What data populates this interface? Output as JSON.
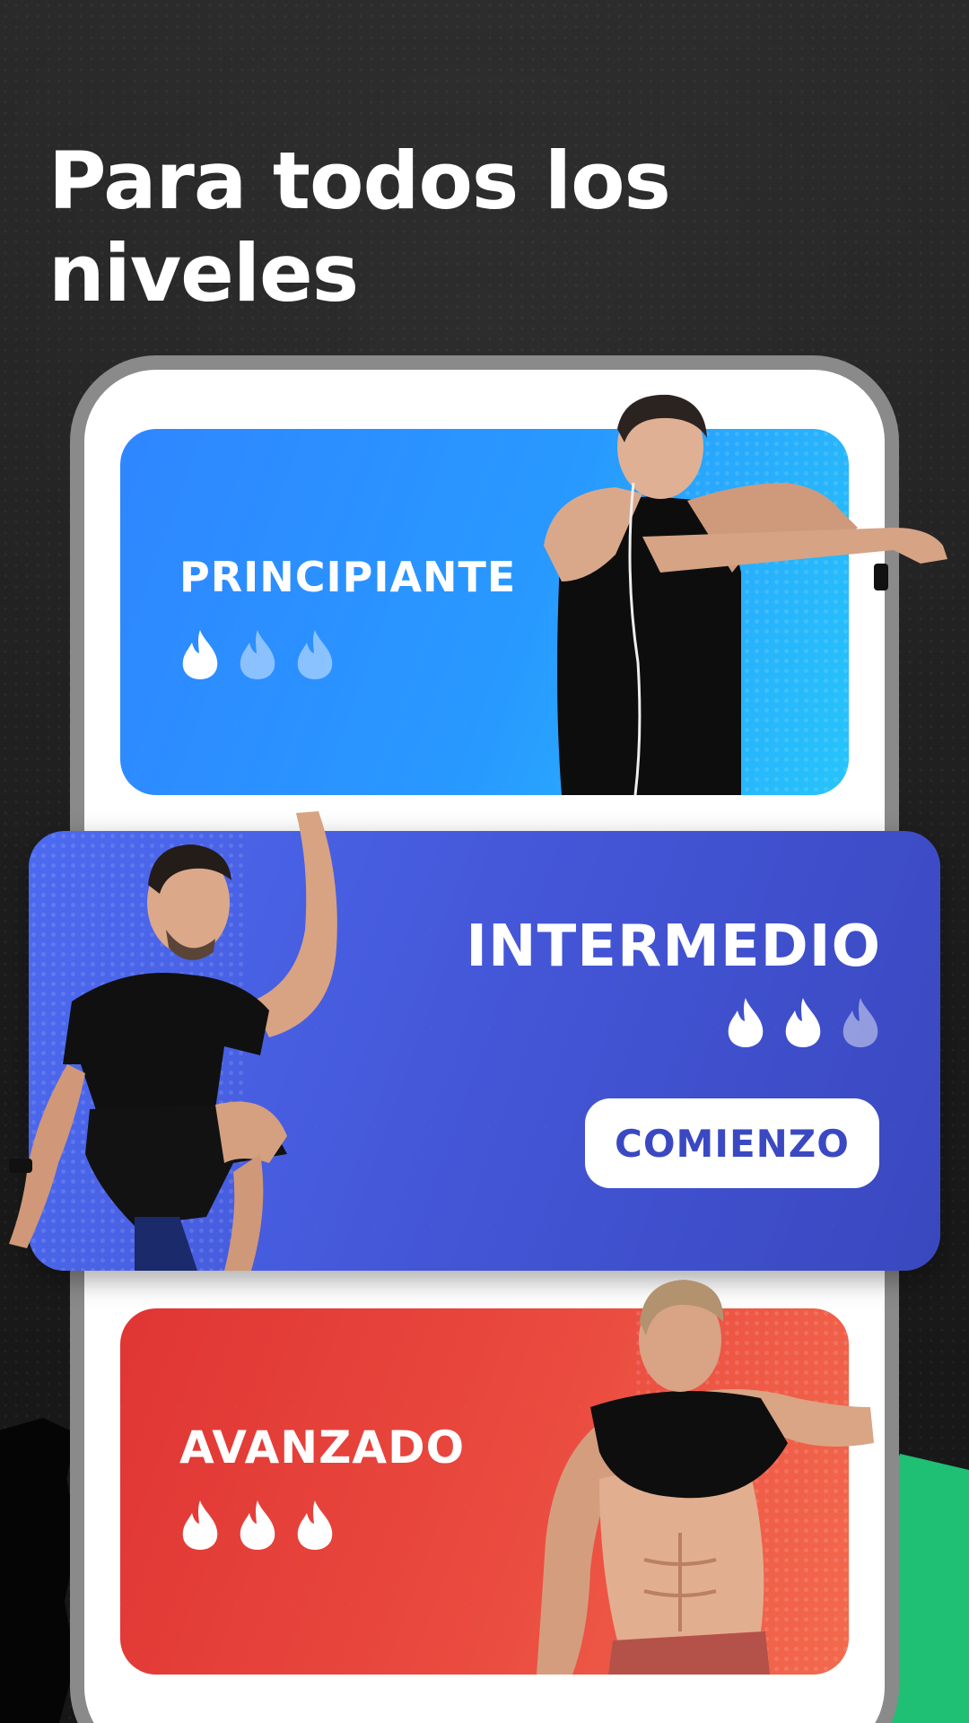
{
  "headline": "Para todos los niveles",
  "levels": {
    "beginner": {
      "title": "PRINCIPIANTE",
      "intensity": 1,
      "max_intensity": 3,
      "color": "#2899ff"
    },
    "intermediate": {
      "title": "INTERMEDIO",
      "intensity": 2,
      "max_intensity": 3,
      "color": "#4558da",
      "button_label": "COMIENZO"
    },
    "advanced": {
      "title": "AVANZADO",
      "intensity": 3,
      "max_intensity": 3,
      "color": "#ea4b3f"
    }
  },
  "icons": {
    "intensity": "flame-icon"
  },
  "colors": {
    "background": "#1c1c1c",
    "accent_green": "#1fbf74",
    "phone_frame": "#8a8a8a"
  }
}
